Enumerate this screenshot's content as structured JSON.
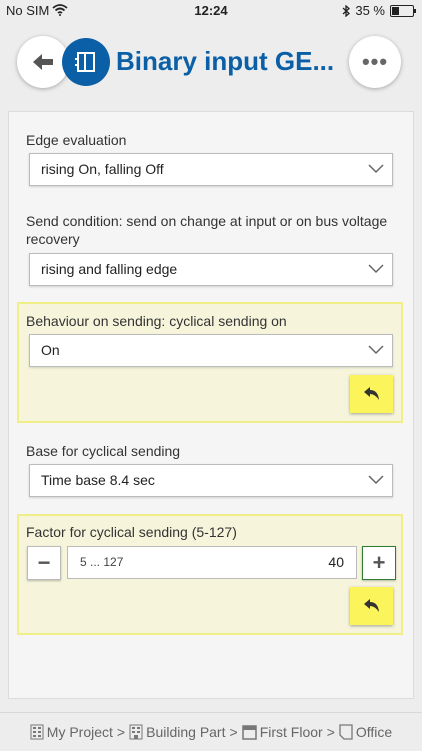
{
  "status_bar": {
    "carrier": "No SIM",
    "time": "12:24",
    "battery": "35 %",
    "battery_level": 0.35
  },
  "header": {
    "title": "Binary input GE..."
  },
  "fields": {
    "edge": {
      "label": "Edge evaluation",
      "value": "rising On, falling Off"
    },
    "send_condition": {
      "label_line1": "Send condition: send on change at input or on bus voltage",
      "label_line2": "recovery",
      "value": "rising and falling edge"
    },
    "behaviour": {
      "label": "Behaviour on sending: cyclical sending on",
      "value": "On"
    },
    "base": {
      "label": "Base for cyclical sending",
      "value": "Time base 8.4 sec"
    },
    "factor": {
      "label": "Factor for cyclical sending (5-127)",
      "placeholder": "5 ... 127",
      "value": "40",
      "minus": "−",
      "plus": "+"
    }
  },
  "breadcrumb": {
    "items": [
      "My Project",
      "Building Part",
      "First Floor",
      "Office"
    ],
    "separator": ">"
  },
  "colors": {
    "accent": "#0a5fa6",
    "highlight_bg": "#f6f5dc",
    "highlight_border": "#f0ee86",
    "reset_button": "#fbf45a"
  }
}
